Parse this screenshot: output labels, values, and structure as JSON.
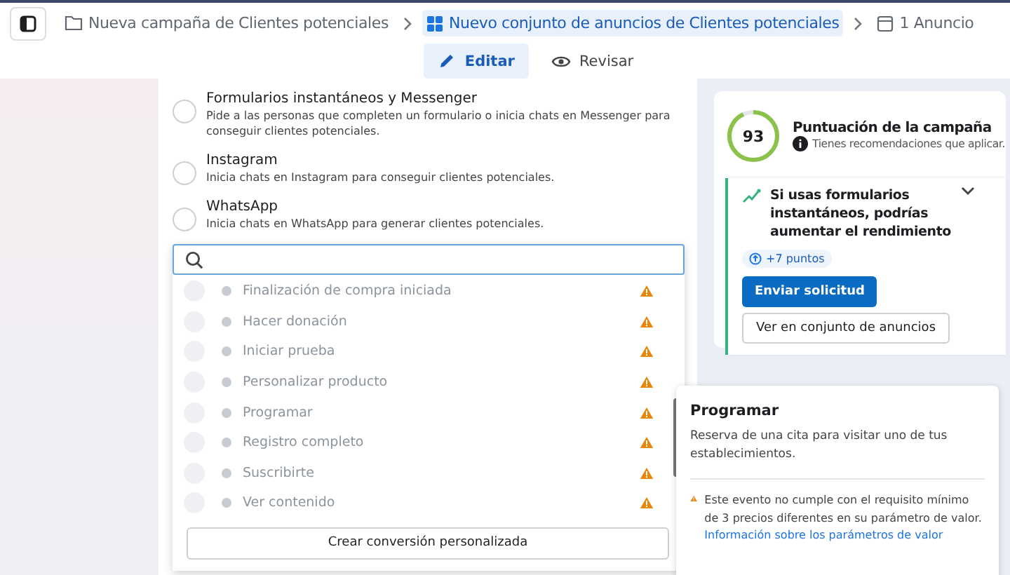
{
  "breadcrumbs": [
    {
      "kind": "campaign",
      "label": "Nueva campaña de Clientes potenciales",
      "selected": false
    },
    {
      "kind": "adset",
      "label": "Nuevo conjunto de anuncios de Clientes potenciales",
      "selected": true
    },
    {
      "kind": "ad",
      "label": "1 Anuncio",
      "selected": false
    }
  ],
  "modes": [
    {
      "kind": "edit",
      "label": "Editar",
      "selected": true
    },
    {
      "kind": "review",
      "label": "Revisar",
      "selected": false
    }
  ],
  "options": [
    {
      "title": "Formularios instantáneos y Messenger",
      "description": "Pide a las personas que completen un formulario o inicia chats en Messenger para conseguir clientes potenciales.",
      "selected": false
    },
    {
      "title": "Instagram",
      "description": "Inicia chats en Instagram para conseguir clientes potenciales.",
      "selected": false
    },
    {
      "title": "WhatsApp",
      "description": "Inicia chats en WhatsApp para generar clientes potenciales.",
      "selected": false
    }
  ],
  "dropdown": {
    "events": [
      {
        "label": "Finalización de compra iniciada",
        "warning": true,
        "disabled": true
      },
      {
        "label": "Hacer donación",
        "warning": true,
        "disabled": true
      },
      {
        "label": "Iniciar prueba",
        "warning": true,
        "disabled": true
      },
      {
        "label": "Personalizar producto",
        "warning": true,
        "disabled": true
      },
      {
        "label": "Programar",
        "warning": true,
        "disabled": true
      },
      {
        "label": "Registro completo",
        "warning": true,
        "disabled": true
      },
      {
        "label": "Suscribirte",
        "warning": true,
        "disabled": true
      },
      {
        "label": "Ver contenido",
        "warning": true,
        "disabled": true
      }
    ],
    "button": "Crear conversión personalizada"
  },
  "score": {
    "value": "93",
    "level": 0.93,
    "title": "Puntuación de la campaña",
    "subtitle": "Tienes recomendaciones que aplicar.",
    "recommendation": {
      "title": "Si usas formularios instantáneos, podrías aumentar el rendimiento",
      "points": "+7 puntos",
      "primary": "Enviar solicitud",
      "secondary": "Ver en conjunto de anuncios"
    }
  },
  "tooltip": {
    "title": "Programar",
    "description": "Reserva de una cita para visitar uno de tus establecimientos.",
    "warning": "Este evento no cumple con el requisito mínimo de 3 precios diferentes en su parámetro de valor.",
    "link": "Información sobre los parámetros de valor"
  }
}
